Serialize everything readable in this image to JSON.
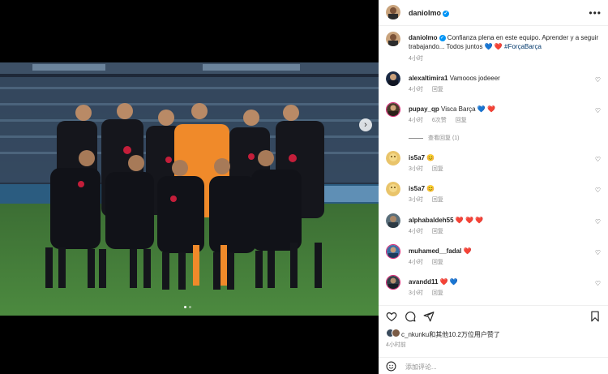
{
  "post": {
    "author": "danioImo",
    "caption_author": "danioImo",
    "caption_text": "Confianza plena en este equipo. Aprender y a seguir trabajando... Todos juntos",
    "caption_hearts": [
      "💙",
      "❤️"
    ],
    "caption_hashtag": "#ForçaBarça",
    "caption_time": "4小时",
    "photo_alt": "Team photo of FC Barcelona players on the pitch",
    "carousel_dots": 2,
    "carousel_active": 0
  },
  "comments": [
    {
      "user": "alexaltimira1",
      "text": "Vamooos jodeeer",
      "time": "4小时",
      "reply": "回复",
      "likes": "",
      "avatar_color": "#1b2a44"
    },
    {
      "user": "pupay_qp",
      "text": "Visca Barça",
      "emoji": [
        "💙",
        "❤️"
      ],
      "time": "4小时",
      "likes": "6次赞",
      "reply": "回复",
      "avatar_color": "#4a3a2a",
      "story_ring": true
    },
    {
      "view_replies": "查看回复 (1)"
    },
    {
      "user": "is5a7",
      "emoji": [
        "😊"
      ],
      "time": "3小时",
      "reply": "回复",
      "avatar_color": "#e9c46a"
    },
    {
      "user": "is5a7",
      "emoji": [
        "😊"
      ],
      "time": "3小时",
      "reply": "回复",
      "avatar_color": "#e9c46a"
    },
    {
      "user": "alphabaldeh55",
      "emoji": [
        "❤️",
        "❤️",
        "❤️"
      ],
      "time": "4小时",
      "reply": "回复",
      "avatar_color": "#5a6e7a"
    },
    {
      "user": "muhamed__fadal",
      "emoji": [
        "❤️"
      ],
      "time": "4小时",
      "reply": "回复",
      "avatar_color": "#3b6ea5",
      "story_ring": true
    },
    {
      "user": "avandd11",
      "emoji": [
        "❤️",
        "💙"
      ],
      "time": "3小时",
      "reply": "回复",
      "avatar_color": "#333d47",
      "story_ring": true
    }
  ],
  "likes": {
    "text": "c_nkunku和其他10.2万位用户赞了",
    "time": "4小时前"
  },
  "add_comment": {
    "placeholder": "添加评论..."
  },
  "icons": {
    "more": "more-horizontal-icon",
    "like": "heart-outline-icon",
    "comment": "comment-icon",
    "share": "send-icon",
    "save": "bookmark-icon",
    "emoji": "smiley-icon",
    "next": "chevron-right-icon",
    "verified": "verified-badge-icon"
  },
  "colors": {
    "verified": "#0095f6",
    "heart_red": "#ed4956",
    "heart_blue": "#1f6fd4",
    "secondary_text": "#8e8e8e",
    "hashtag": "#00376b",
    "gk_kit": "#f08a2a",
    "team_kit": "#15161c"
  }
}
